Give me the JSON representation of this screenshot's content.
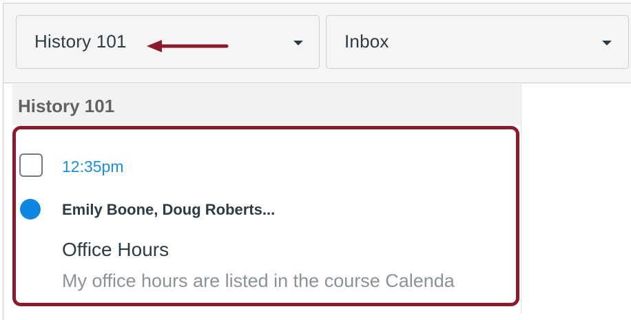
{
  "toolbar": {
    "course_select": {
      "value": "History 101",
      "caret_icon": "caret-down-icon"
    },
    "mailbox_select": {
      "value": "Inbox",
      "caret_icon": "caret-down-icon"
    }
  },
  "annotation": {
    "arrow_color": "#8b1b2c",
    "highlight_color": "#8b1b2c"
  },
  "list": {
    "header": "History 101",
    "messages": [
      {
        "selected": false,
        "unread": true,
        "time": "12:35pm",
        "participants": "Emily Boone, Doug Roberts...",
        "subject": "Office Hours",
        "preview": "My office hours are listed in the course Calenda"
      }
    ]
  },
  "colors": {
    "time": "#1a8fd6",
    "unread_dot": "#0d87e0",
    "preview": "#8b9299",
    "text": "#2d3b45"
  }
}
